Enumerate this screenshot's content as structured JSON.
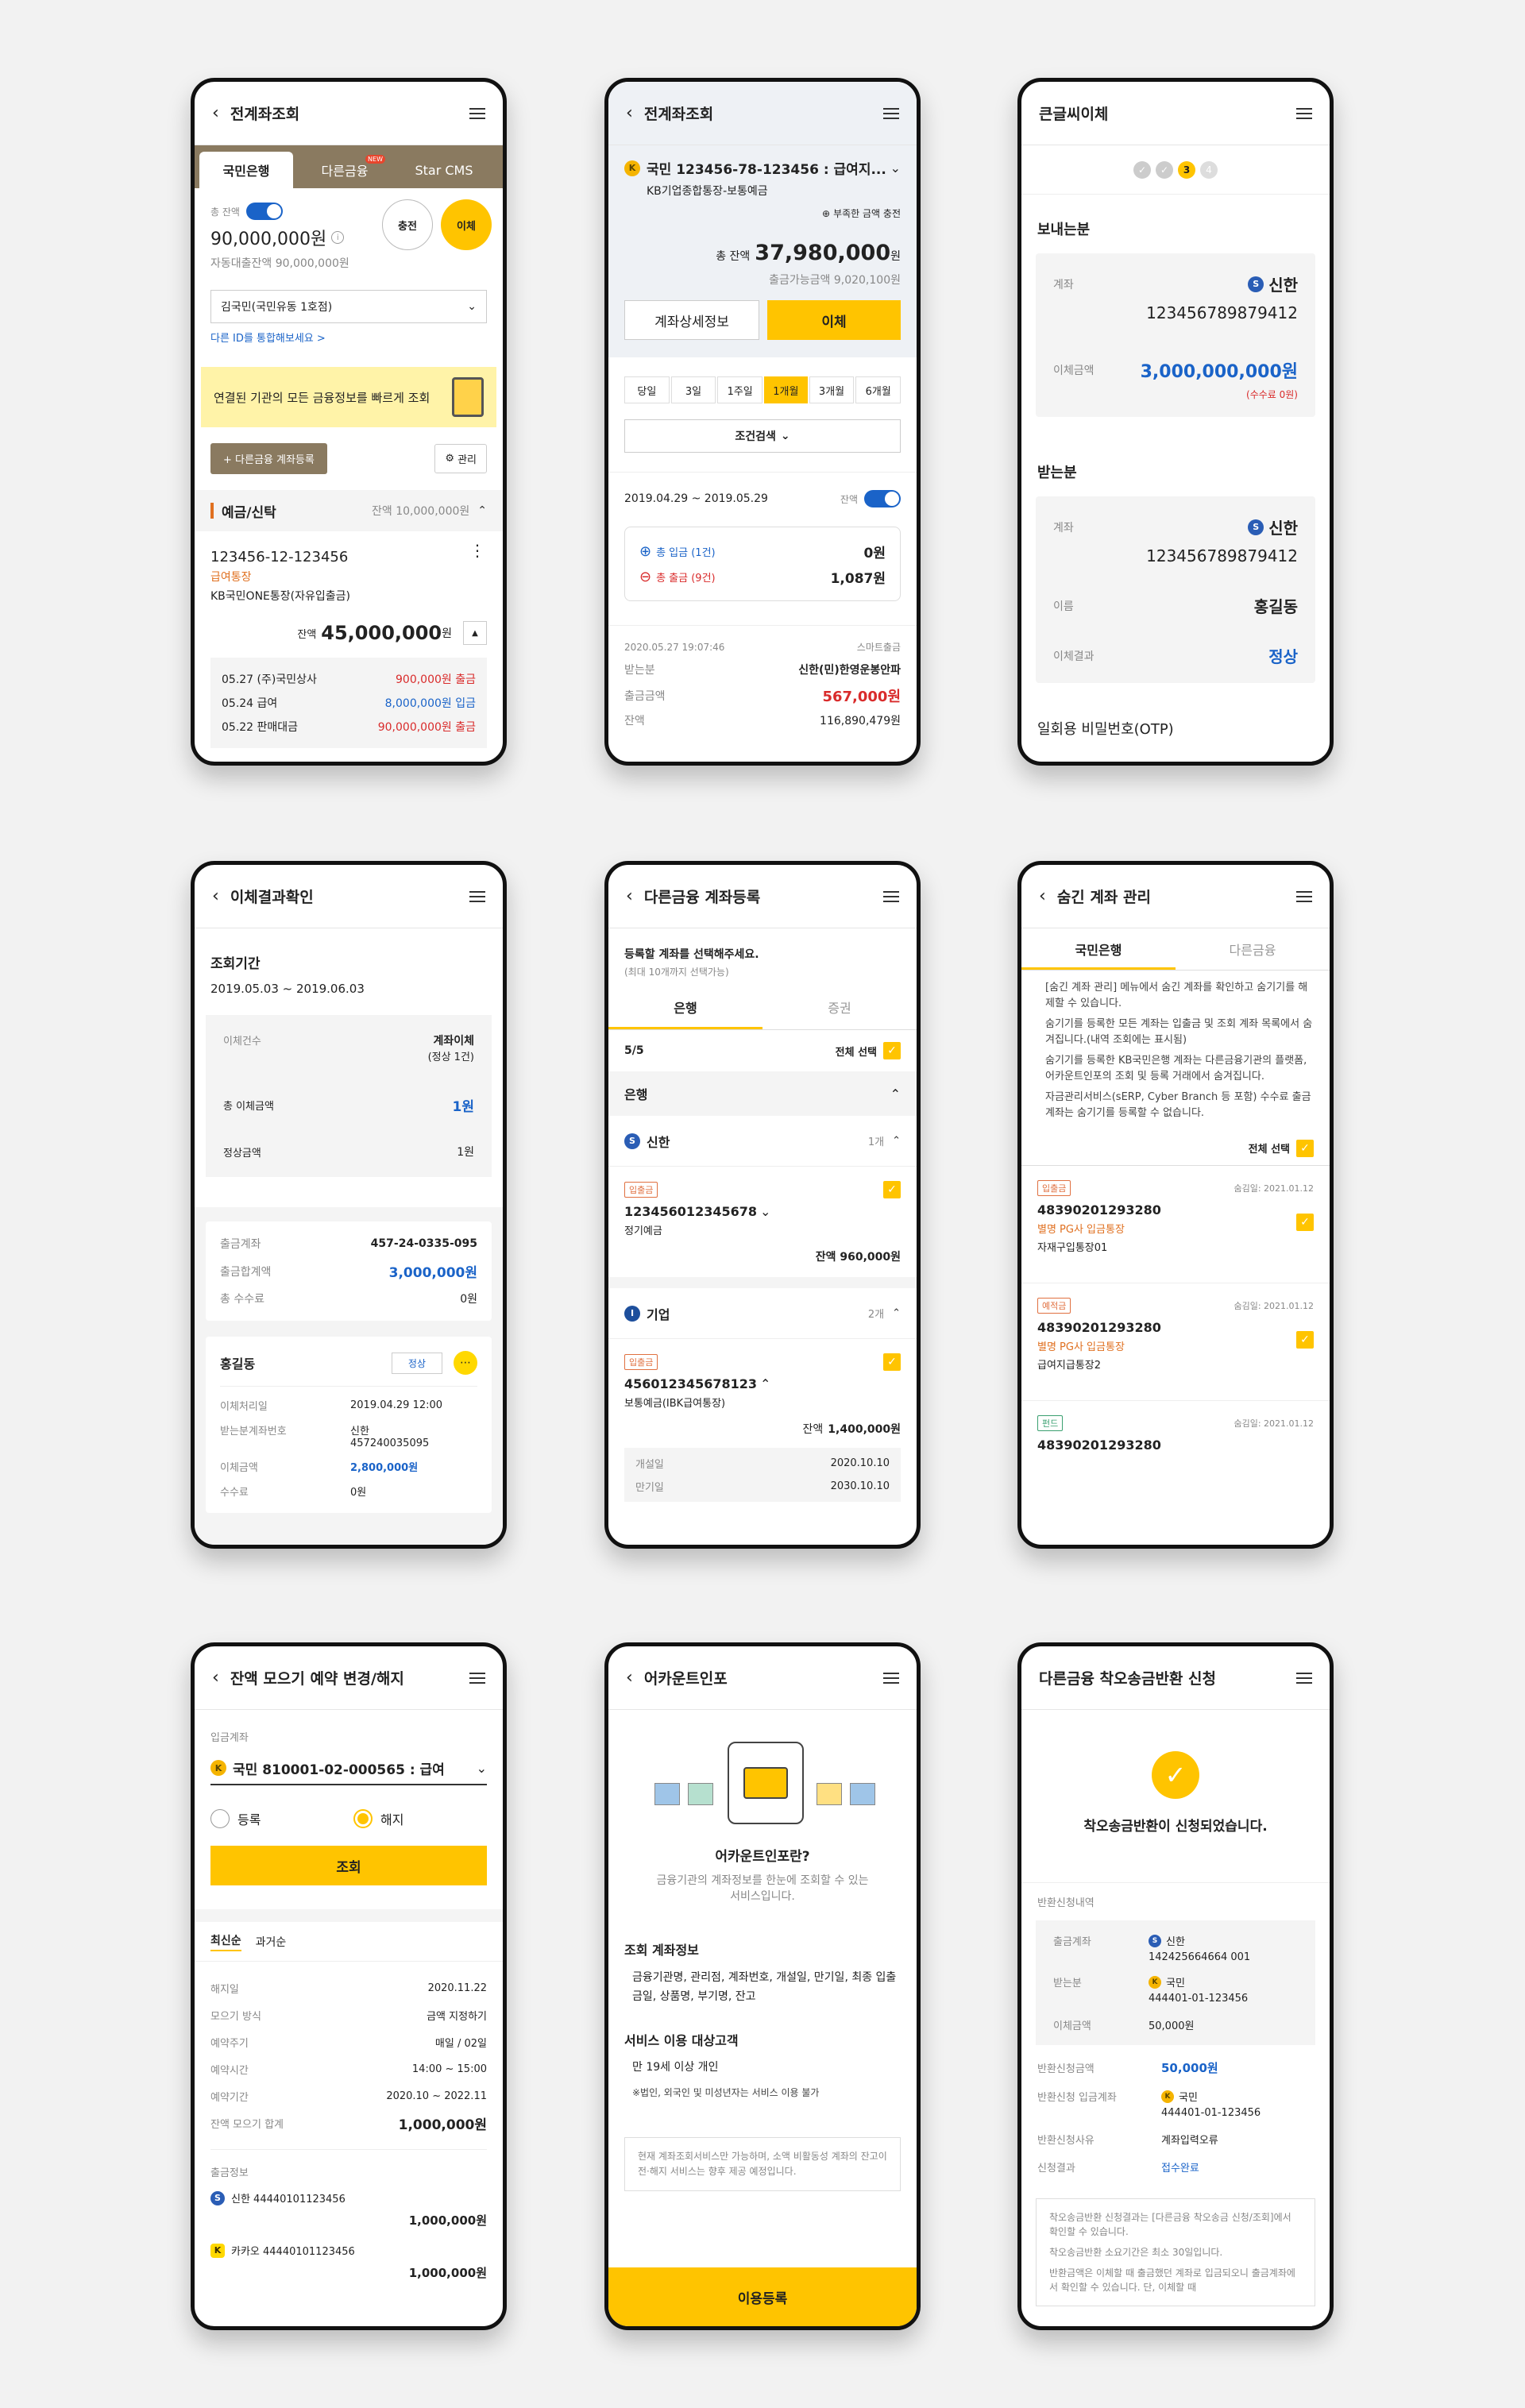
{
  "p1": {
    "title": "전계좌조회",
    "tabs": [
      "국민은행",
      "다른금융",
      "Star CMS"
    ],
    "tab_badge": "NEW",
    "toggle_label": "총 잔액",
    "balance": "90,000,000원",
    "auto_loan": "자동대출잔액 90,000,000원",
    "charge": "충전",
    "transfer": "이체",
    "branch": "김국민(국민유동 1호점)",
    "other_id": "다른 ID를 통합해보세요 >",
    "banner": "연결된 기관의 모든 금융정보를 빠르게 조회",
    "add_btn": "+ 다른금융 계좌등록",
    "manage": "관리",
    "section": "예금/신탁",
    "section_bal": "잔액 10,000,000원",
    "acct_no": "123456-12-123456",
    "acct_type": "급여통장",
    "acct_name": "KB국민ONE통장(자유입출금)",
    "bal_label": "잔액",
    "bal": "45,000,000",
    "won": "원",
    "tx": [
      {
        "d": "05.27 (주)국민상사",
        "a": "900,000원",
        "t": "출금"
      },
      {
        "d": "05.24 급여",
        "a": "8,000,000원",
        "t": "입금"
      },
      {
        "d": "05.22 판매대금",
        "a": "90,000,000원",
        "t": "출금"
      }
    ]
  },
  "p2": {
    "title": "전계좌조회",
    "acct": "국민 123456-78-123456 : 급여지...",
    "acct_sub": "KB기업종합통장-보통예금",
    "charge_link": "부족한 금액 충전",
    "total_label": "총 잔액",
    "total": "37,980,000",
    "won": "원",
    "avail": "출금가능금액 9,020,100원",
    "detail_btn": "계좌상세정보",
    "transfer_btn": "이체",
    "periods": [
      "당일",
      "3일",
      "1주일",
      "1개월",
      "3개월",
      "6개월"
    ],
    "search": "조건검색",
    "range": "2019.04.29 ~ 2019.05.29",
    "toggle_label": "잔액",
    "in_label": "총 입금 (1건)",
    "in_amt": "0원",
    "out_label": "총 출금 (9건)",
    "out_amt": "1,087원",
    "tx_date": "2020.05.27 19:07:46",
    "tx_ch": "스마트출금",
    "r1l": "받는분",
    "r1v": "신한(민)한영운봉안파",
    "r2l": "출금금액",
    "r2v": "567,000원",
    "r3l": "잔액",
    "r3v": "116,890,479원"
  },
  "p3": {
    "title": "큰글씨이체",
    "steps": [
      "✓",
      "✓",
      "3",
      "4"
    ],
    "sender": "보내는분",
    "acct_label": "계좌",
    "bank": "신한",
    "acct_no": "123456789879412",
    "amt_label": "이체금액",
    "amt": "3,000,000,000원",
    "fee": "(수수료 0원)",
    "receiver": "받는분",
    "r_acct_label": "계좌",
    "r_bank": "신한",
    "r_acct_no": "123456789879412",
    "name_label": "이름",
    "name": "홍길동",
    "result_label": "이체결과",
    "result": "정상",
    "otp": "일회용 비밀번호(OTP)"
  },
  "p4": {
    "title": "이체결과확인",
    "period_label": "조회기간",
    "period": "2019.05.03 ~ 2019.06.03",
    "c_label": "이체건수",
    "c_val": "계좌이체",
    "c_sub": "(정상 1건)",
    "t_label": "총 이체금액",
    "t_val": "1원",
    "n_label": "정상금액",
    "n_val": "1원",
    "o1l": "출금계좌",
    "o1v": "457-24-0335-095",
    "o2l": "출금합계액",
    "o2v": "3,000,000원",
    "o3l": "총 수수료",
    "o3v": "0원",
    "name": "홍길동",
    "status": "정상",
    "d1l": "이체처리일",
    "d1v": "2019.04.29  12:00",
    "d2l": "받는분계좌번호",
    "d2v": "신한",
    "d2v2": "457240035095",
    "d3l": "이체금액",
    "d3v": "2,800,000원",
    "d4l": "수수료",
    "d4v": "0원"
  },
  "p5": {
    "title": "다른금융 계좌등록",
    "prompt": "등록할 계좌를 선택해주세요.",
    "prompt_sub": "(최대 10개까지 선택가능)",
    "tabs": [
      "은행",
      "증권"
    ],
    "count": "5/5",
    "select_all": "전체 선택",
    "group": "은행",
    "b1": "신한",
    "b1c": "1개",
    "a1_tag": "입출금",
    "a1_no": "123456012345678",
    "a1_type": "정기예금",
    "a1_bal": "잔액 960,000원",
    "b2": "기업",
    "b2c": "2개",
    "a2_tag": "입출금",
    "a2_no": "456012345678123",
    "a2_type": "보통예금(IBK급여통장)",
    "a2_bal_label": "잔액",
    "a2_bal": "1,400,000원",
    "o1l": "개설일",
    "o1v": "2020.10.10",
    "o2l": "만기일",
    "o2v": "2030.10.10"
  },
  "p6": {
    "title": "숨긴 계좌 관리",
    "tabs": [
      "국민은행",
      "다른금융"
    ],
    "notes": [
      "[숨긴 계좌 관리] 메뉴에서 숨긴 계좌를 확인하고 숨기기를 해제할 수 있습니다.",
      "숨기기를 등록한 모든 계좌는 입출금 및 조회 계좌 목록에서 숨겨집니다.(내역 조회에는 표시됨)",
      "숨기기를 등록한 KB국민은행 계좌는 다른금융기관의 플랫폼, 어카운트인포의 조회 및 등록 거래에서 숨겨집니다.",
      "자금관리서비스(sERP, Cyber Branch 등 포함) 수수료 출금계좌는 숨기기를 등록할 수 없습니다."
    ],
    "select_all": "전체 선택",
    "items": [
      {
        "tag": "입출금",
        "date": "숨김일: 2021.01.12",
        "no": "48390201293280",
        "sub": "별명 PG사 입금통장",
        "name": "자재구입통장01"
      },
      {
        "tag": "예적금",
        "date": "숨김일: 2021.01.12",
        "no": "48390201293280",
        "sub": "별명 PG사 입금통장",
        "name": "급여지급통장2"
      },
      {
        "tag": "펀드",
        "date": "숨김일: 2021.01.12",
        "no": "48390201293280"
      }
    ]
  },
  "p7": {
    "title": "잔액 모으기 예약 변경/해지",
    "in_label": "입금계좌",
    "acct": "국민 810001-02-000565 : 급여",
    "radio1": "등록",
    "radio2": "해지",
    "btn": "조회",
    "sort1": "최신순",
    "sort2": "과거순",
    "rows": [
      {
        "l": "해지일",
        "v": "2020.11.22"
      },
      {
        "l": "모으기 방식",
        "v": "금액 지정하기"
      },
      {
        "l": "예약주기",
        "v": "매일 / 02일"
      },
      {
        "l": "예약시간",
        "v": "14:00 ~ 15:00"
      },
      {
        "l": "예약기간",
        "v": "2020.10 ~ 2022.11"
      }
    ],
    "total_l": "잔액 모으기 합계",
    "total_v": "1,000,000원",
    "out_label": "출금정보",
    "o1": "신한 44440101123456",
    "o1v": "1,000,000원",
    "o2": "카카오 44440101123456",
    "o2v": "1,000,000원"
  },
  "p8": {
    "title": "어카운트인포",
    "q": "어카운트인포란?",
    "desc": "금융기관의 계좌정보를 한눈에 조회할 수 있는 서비스입니다.",
    "h1": "조회 계좌정보",
    "b1": "금융기관명, 관리점, 계좌번호, 개설일, 만기일, 최종 입출금일, 상품명, 부기명, 잔고",
    "h2": "서비스 이용 대상고객",
    "b2": "만 19세 이상 개인",
    "b2n": "※법인, 외국인 및 미성년자는 서비스 이용 불가",
    "note": "현재 계좌조회서비스만 가능하며, 소액 비활동성 계좌의 잔고이전·해지 서비스는 향후 제공 예정입니다.",
    "btn": "이용등록"
  },
  "p9": {
    "title": "다른금융 착오송금반환 신청",
    "done": "착오송금반환이 신청되었습니다.",
    "sec_label": "반환신청내역",
    "r1l": "출금계좌",
    "r1b": "신한",
    "r1v": "142425664664 001",
    "r2l": "받는분",
    "r2b": "국민",
    "r2v": "444401-01-123456",
    "r3l": "이체금액",
    "r3v": "50,000원",
    "r4l": "반환신청금액",
    "r4v": "50,000원",
    "r5l": "반환신청 입금계좌",
    "r5b": "국민",
    "r5v": "444401-01-123456",
    "r6l": "반환신청사유",
    "r6v": "계좌입력오류",
    "r7l": "신청결과",
    "r7v": "접수완료",
    "notes": [
      "착오송금반환 신청결과는 [다른금융 착오송금 신청/조회]에서 확인할 수 있습니다.",
      "착오송금반환 소요기간은 최소 30일입니다.",
      "반환금액은 이체할 때 출금했던 계좌로 입금되오니 출금계좌에서 확인할 수 있습니다. 단, 이체할 때"
    ]
  }
}
